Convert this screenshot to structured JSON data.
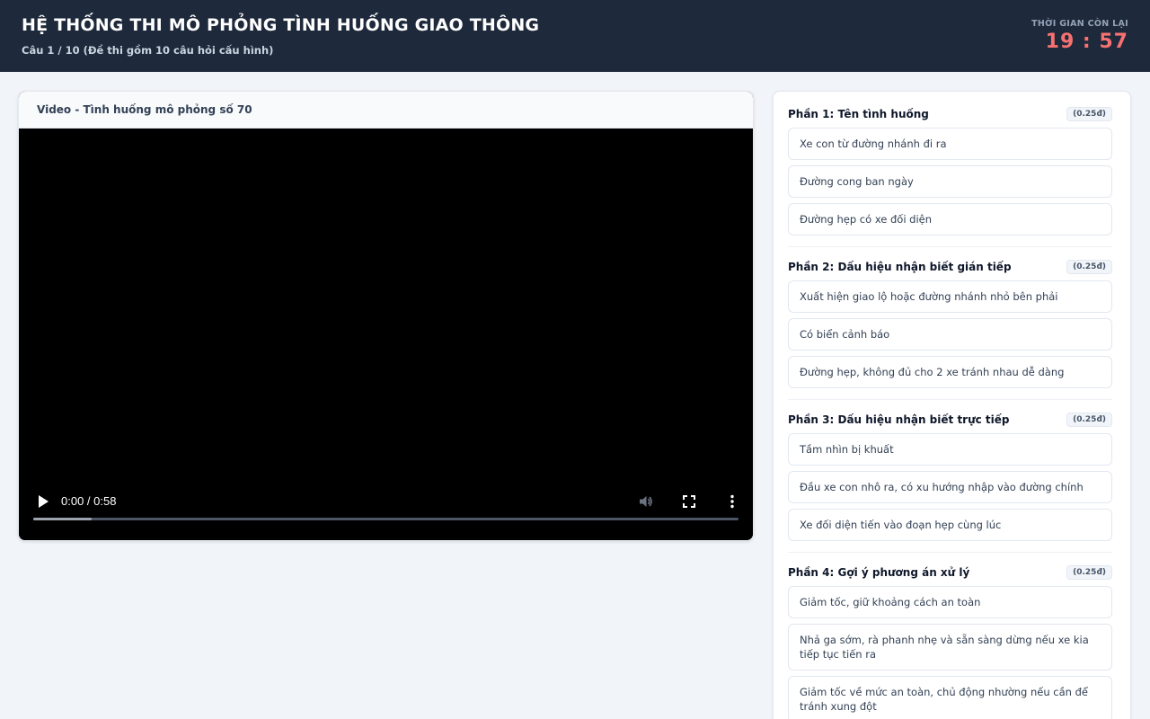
{
  "header": {
    "title": "HỆ THỐNG THI MÔ PHỎNG TÌNH HUỐNG GIAO THÔNG",
    "subtitle": "Câu 1 / 10 (Đề thi gồm 10 câu hỏi cấu hình)",
    "timer_label": "THỜI GIAN CÒN LẠI",
    "timer_value": "19 : 57"
  },
  "video": {
    "title": "Video - Tình huống mô phỏng số 70",
    "time": "0:00 / 0:58",
    "buffered_fraction": 0.083,
    "icons": [
      "play-icon",
      "volume-icon",
      "fullscreen-icon",
      "more-options-icon"
    ]
  },
  "sections": [
    {
      "title": "Phần 1: Tên tình huống",
      "points": "(0.25đ)",
      "options": [
        "Xe con từ đường nhánh đi ra",
        "Đường cong ban ngày",
        "Đường hẹp có xe đối diện"
      ]
    },
    {
      "title": "Phần 2: Dấu hiệu nhận biết gián tiếp",
      "points": "(0.25đ)",
      "options": [
        "Xuất hiện giao lộ hoặc đường nhánh nhỏ bên phải",
        "Có biển cảnh báo",
        "Đường hẹp, không đủ cho 2 xe tránh nhau dễ dàng"
      ]
    },
    {
      "title": "Phần 3: Dấu hiệu nhận biết trực tiếp",
      "points": "(0.25đ)",
      "options": [
        "Tầm nhìn bị khuất",
        "Đầu xe con nhô ra, có xu hướng nhập vào đường chính",
        "Xe đối diện tiến vào đoạn hẹp cùng lúc"
      ]
    },
    {
      "title": "Phần 4: Gợi ý phương án xử lý",
      "points": "(0.25đ)",
      "options": [
        "Giảm tốc, giữ khoảng cách an toàn",
        "Nhả ga sớm, rà phanh nhẹ và sẵn sàng dừng nếu xe kia tiếp tục tiến ra",
        "Giảm tốc về mức an toàn, chủ động nhường nếu cần để tránh xung đột"
      ]
    }
  ],
  "colors": {
    "header_bg": "#1e293b",
    "timer": "#f87171",
    "page_bg": "#f1f4f8"
  }
}
